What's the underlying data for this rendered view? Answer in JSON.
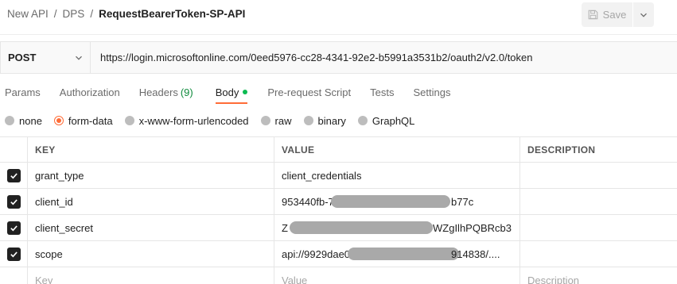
{
  "breadcrumb": {
    "items": [
      "New API",
      "DPS"
    ],
    "separator": "/",
    "current": "RequestBearerToken-SP-API"
  },
  "toolbar": {
    "save_label": "Save",
    "save_icon": "save-icon",
    "dropdown_icon": "chevron-down-icon"
  },
  "request": {
    "method": "POST",
    "url": "https://login.microsoftonline.com/0eed5976-cc28-4341-92e2-b5991a3531b2/oauth2/v2.0/token"
  },
  "tabs": [
    {
      "label": "Params",
      "count": ""
    },
    {
      "label": "Authorization",
      "count": ""
    },
    {
      "label": "Headers",
      "count": "(9)"
    },
    {
      "label": "Body",
      "count": "",
      "active": true
    },
    {
      "label": "Pre-request Script",
      "count": ""
    },
    {
      "label": "Tests",
      "count": ""
    },
    {
      "label": "Settings",
      "count": ""
    }
  ],
  "body_types": [
    {
      "label": "none",
      "selected": false
    },
    {
      "label": "form-data",
      "selected": true
    },
    {
      "label": "x-www-form-urlencoded",
      "selected": false
    },
    {
      "label": "raw",
      "selected": false
    },
    {
      "label": "binary",
      "selected": false
    },
    {
      "label": "GraphQL",
      "selected": false
    }
  ],
  "table": {
    "headers": {
      "key": "KEY",
      "value": "VALUE",
      "description": "DESCRIPTION"
    },
    "rows": [
      {
        "checked": true,
        "key": "grant_type",
        "value_start": "client_credentials",
        "value_end": "",
        "description": ""
      },
      {
        "checked": true,
        "key": "client_id",
        "value_start": "953440fb-79",
        "value_end": "b77c",
        "description": ""
      },
      {
        "checked": true,
        "key": "client_secret",
        "value_start": "Z",
        "value_end": "WZgIlhPQBRcb3",
        "description": ""
      },
      {
        "checked": true,
        "key": "scope",
        "value_start": "api://9929dae0",
        "value_end": "914838/....",
        "description": ""
      }
    ],
    "placeholder": {
      "key": "Key",
      "value": "Value",
      "description": "Description"
    }
  },
  "colors": {
    "accent": "#ff6c37",
    "tab_count": "#0f8a3c",
    "status_dot": "#0cbb52"
  }
}
